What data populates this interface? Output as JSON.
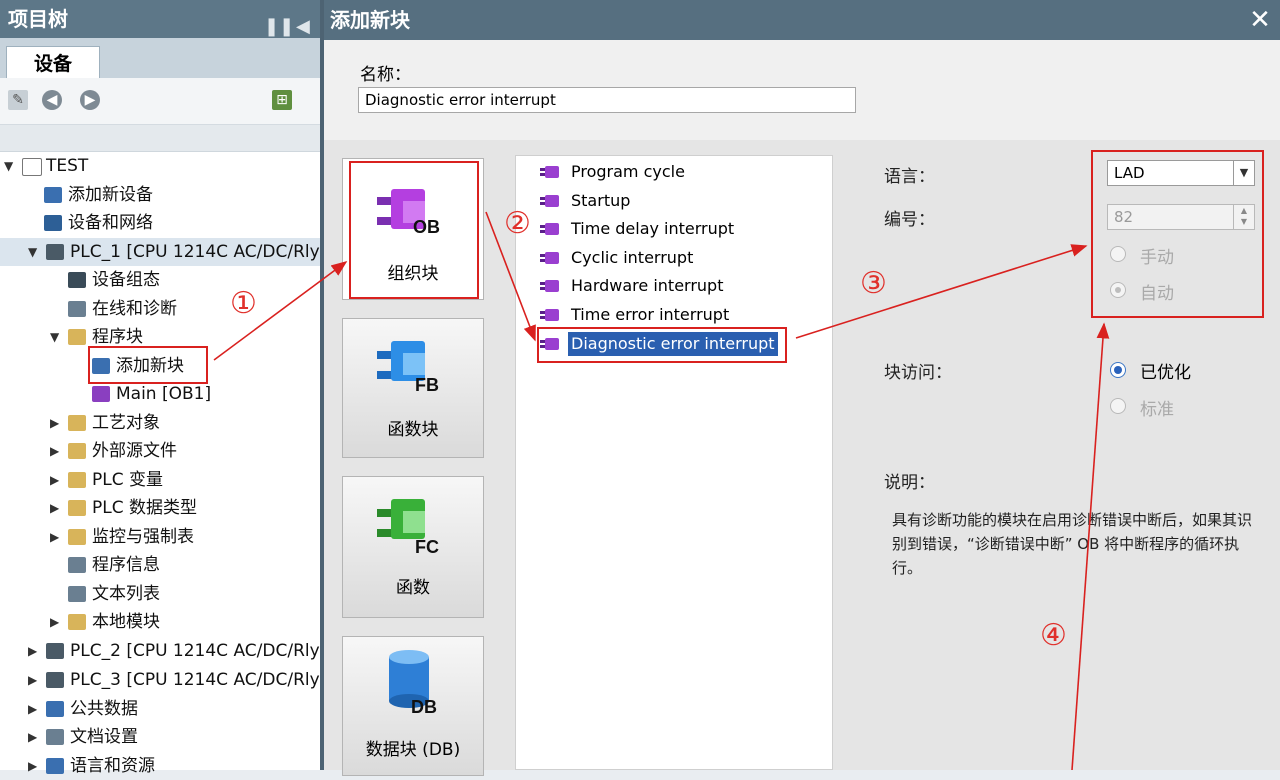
{
  "project_tree": {
    "title": "项目树",
    "tab": "设备",
    "items": [
      {
        "label": "TEST",
        "expanded": true
      },
      {
        "label": "添加新设备"
      },
      {
        "label": "设备和网络"
      },
      {
        "label": "PLC_1 [CPU 1214C AC/DC/Rly]",
        "expanded": true
      },
      {
        "label": "设备组态"
      },
      {
        "label": "在线和诊断"
      },
      {
        "label": "程序块",
        "expanded": true
      },
      {
        "label": "添加新块"
      },
      {
        "label": "Main [OB1]"
      },
      {
        "label": "工艺对象"
      },
      {
        "label": "外部源文件"
      },
      {
        "label": "PLC 变量"
      },
      {
        "label": "PLC 数据类型"
      },
      {
        "label": "监控与强制表"
      },
      {
        "label": "程序信息"
      },
      {
        "label": "文本列表"
      },
      {
        "label": "本地模块"
      },
      {
        "label": "PLC_2 [CPU 1214C AC/DC/Rly]"
      },
      {
        "label": "PLC_3 [CPU 1214C AC/DC/Rly]"
      },
      {
        "label": "公共数据"
      },
      {
        "label": "文档设置"
      },
      {
        "label": "语言和资源"
      }
    ]
  },
  "dialog": {
    "title": "添加新块",
    "name_label": "名称：",
    "name_value": "Diagnostic error interrupt",
    "block_types": [
      {
        "code": "OB",
        "label": "组织块"
      },
      {
        "code": "FB",
        "label": "函数块"
      },
      {
        "code": "FC",
        "label": "函数"
      },
      {
        "code": "DB",
        "label": "数据块 (DB)"
      }
    ],
    "ob_list": [
      "Program cycle",
      "Startup",
      "Time delay interrupt",
      "Cyclic interrupt",
      "Hardware interrupt",
      "Time error interrupt",
      "Diagnostic error interrupt"
    ],
    "properties": {
      "language_label": "语言：",
      "language_value": "LAD",
      "number_label": "编号：",
      "number_value": "82",
      "manual_label": "手动",
      "auto_label": "自动",
      "access_label": "块访问：",
      "optimized_label": "已优化",
      "standard_label": "标准",
      "desc_label": "说明：",
      "description": "具有诊断功能的模块在启用诊断错误中断后，如果其识别到错误，“诊断错误中断” OB 将中断程序的循环执行。"
    }
  },
  "annotations": [
    "①",
    "②",
    "③",
    "④"
  ],
  "colors": {
    "accent_red": "#d9211f",
    "title_bar": "#566f80",
    "selection": "#2a5fb0"
  }
}
